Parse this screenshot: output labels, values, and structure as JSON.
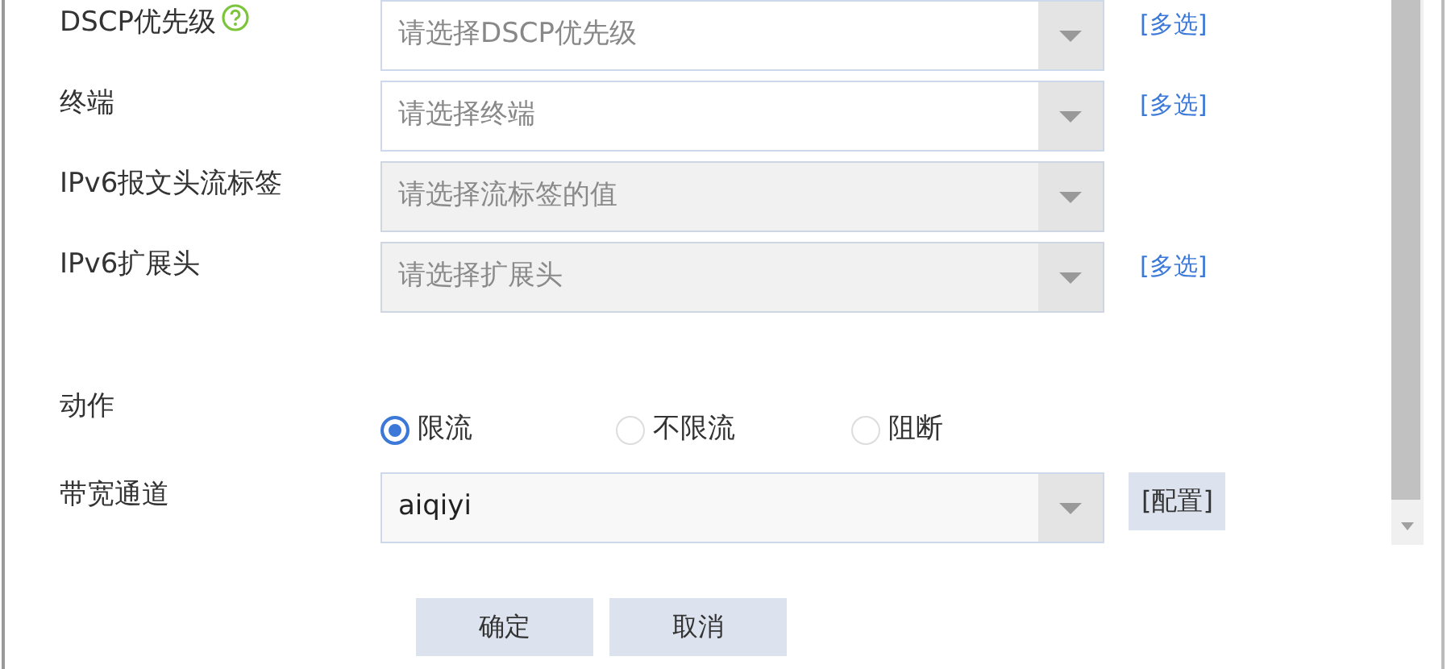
{
  "fields": [
    {
      "label": "DSCP优先级",
      "help": true,
      "placeholder": "请选择DSCP优先级",
      "disabled": false,
      "link": "[多选]"
    },
    {
      "label": "终端",
      "placeholder": "请选择终端",
      "disabled": false,
      "link": "[多选]"
    },
    {
      "label": "IPv6报文头流标签",
      "placeholder": "请选择流标签的值",
      "disabled": true
    },
    {
      "label": "IPv6扩展头",
      "placeholder": "请选择扩展头",
      "disabled": true,
      "link": "[多选]"
    }
  ],
  "action": {
    "label": "动作",
    "options": [
      {
        "label": "限流",
        "selected": true
      },
      {
        "label": "不限流",
        "selected": false
      },
      {
        "label": "阻断",
        "selected": false
      }
    ]
  },
  "bandwidth": {
    "label": "带宽通道",
    "value": "aiqiyi",
    "button": "[配置]"
  },
  "buttons": [
    "确定",
    "取消"
  ]
}
